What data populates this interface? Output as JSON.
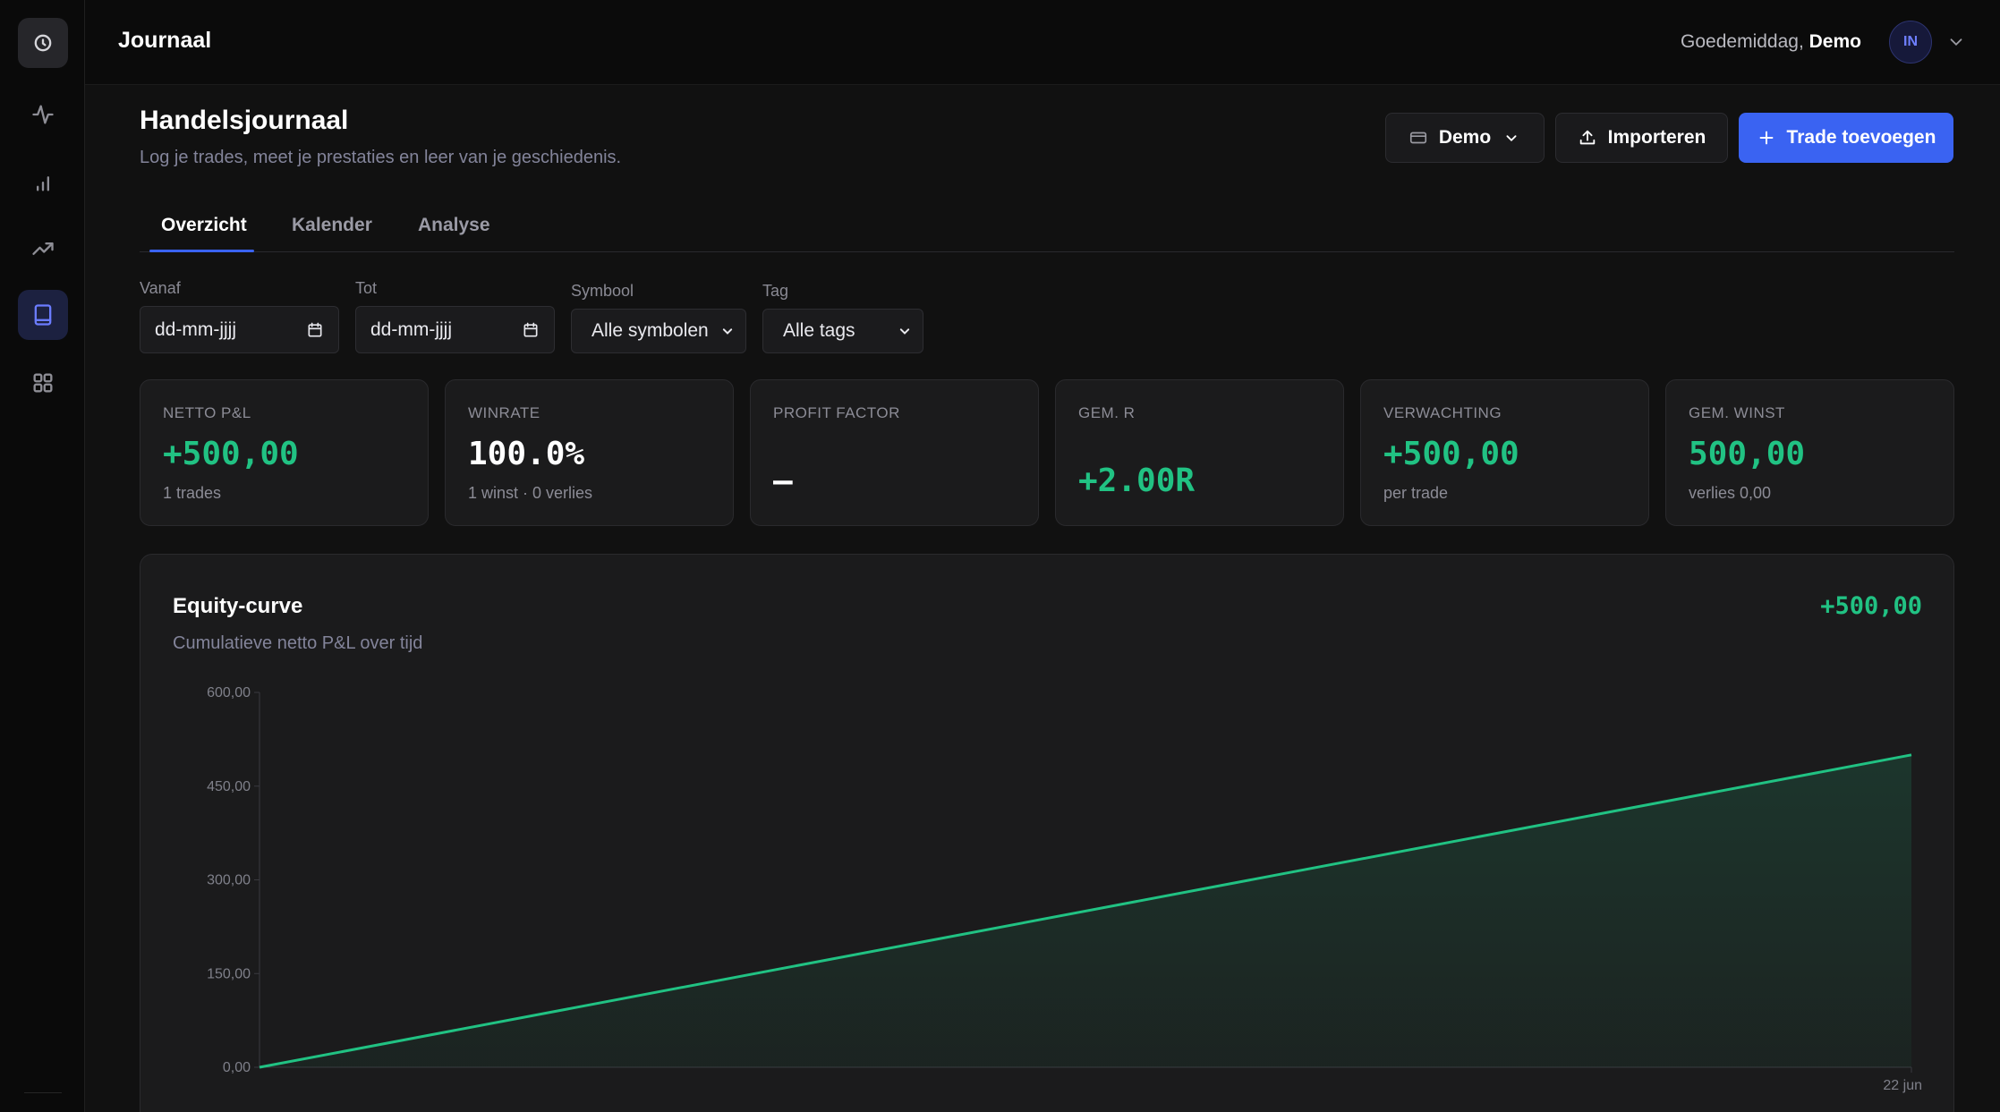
{
  "app": {
    "title": "Journaal"
  },
  "user": {
    "greeting_prefix": "Goedemiddag,",
    "name": "Demo",
    "initials": "IN"
  },
  "sidebar": {
    "items": [
      {
        "name": "clock-icon"
      },
      {
        "name": "activity-icon"
      },
      {
        "name": "bar-chart-icon"
      },
      {
        "name": "trending-up-icon"
      },
      {
        "name": "book-icon",
        "active": true
      },
      {
        "name": "grid-icon"
      }
    ]
  },
  "page": {
    "title": "Handelsjournaal",
    "subtitle": "Log je trades, meet je prestaties en leer van je geschiedenis."
  },
  "actions": {
    "account_label": "Demo",
    "import_label": "Importeren",
    "add_label": "Trade toevoegen"
  },
  "tabs": [
    {
      "label": "Overzicht",
      "active": true
    },
    {
      "label": "Kalender"
    },
    {
      "label": "Analyse"
    }
  ],
  "filters": {
    "from": {
      "label": "Vanaf",
      "value": "dd-mm-jjjj"
    },
    "to": {
      "label": "Tot",
      "value": "dd-mm-jjjj"
    },
    "symbol": {
      "label": "Symbool",
      "value": "Alle symbolen"
    },
    "tag": {
      "label": "Tag",
      "value": "Alle tags"
    }
  },
  "stats": [
    {
      "label": "NETTO P&L",
      "value": "+500,00",
      "sub": "1 trades",
      "positive": true
    },
    {
      "label": "WINRATE",
      "value": "100.0%",
      "sub": "1 winst · 0 verlies",
      "positive": false
    },
    {
      "label": "PROFIT FACTOR",
      "value": "—",
      "sub": "",
      "positive": false
    },
    {
      "label": "GEM. R",
      "value": "+2.00R",
      "sub": "",
      "positive": true
    },
    {
      "label": "VERWACHTING",
      "value": "+500,00",
      "sub": "per trade",
      "positive": true
    },
    {
      "label": "GEM. WINST",
      "value": "500,00",
      "sub": "verlies 0,00",
      "positive": true
    }
  ],
  "equity": {
    "title": "Equity-curve",
    "subtitle": "Cumulatieve netto P&L over tijd",
    "total": "+500,00"
  },
  "colors": {
    "accent": "#3a63f2",
    "positive": "#21c283",
    "background": "#111111",
    "card": "#1b1b1c"
  },
  "chart_data": {
    "type": "area",
    "title": "Equity-curve",
    "subtitle": "Cumulatieve netto P&L over tijd",
    "x": [
      "",
      "22 jun"
    ],
    "values": [
      0,
      500
    ],
    "x_tick_labels": [
      "22 jun"
    ],
    "y_ticks": [
      0,
      150,
      300,
      450,
      600
    ],
    "y_tick_labels": [
      "0,00",
      "150,00",
      "300,00",
      "450,00",
      "600,00"
    ],
    "ylim": [
      0,
      600
    ],
    "xlabel": "",
    "ylabel": "",
    "grid": false,
    "color": "#21c283"
  }
}
